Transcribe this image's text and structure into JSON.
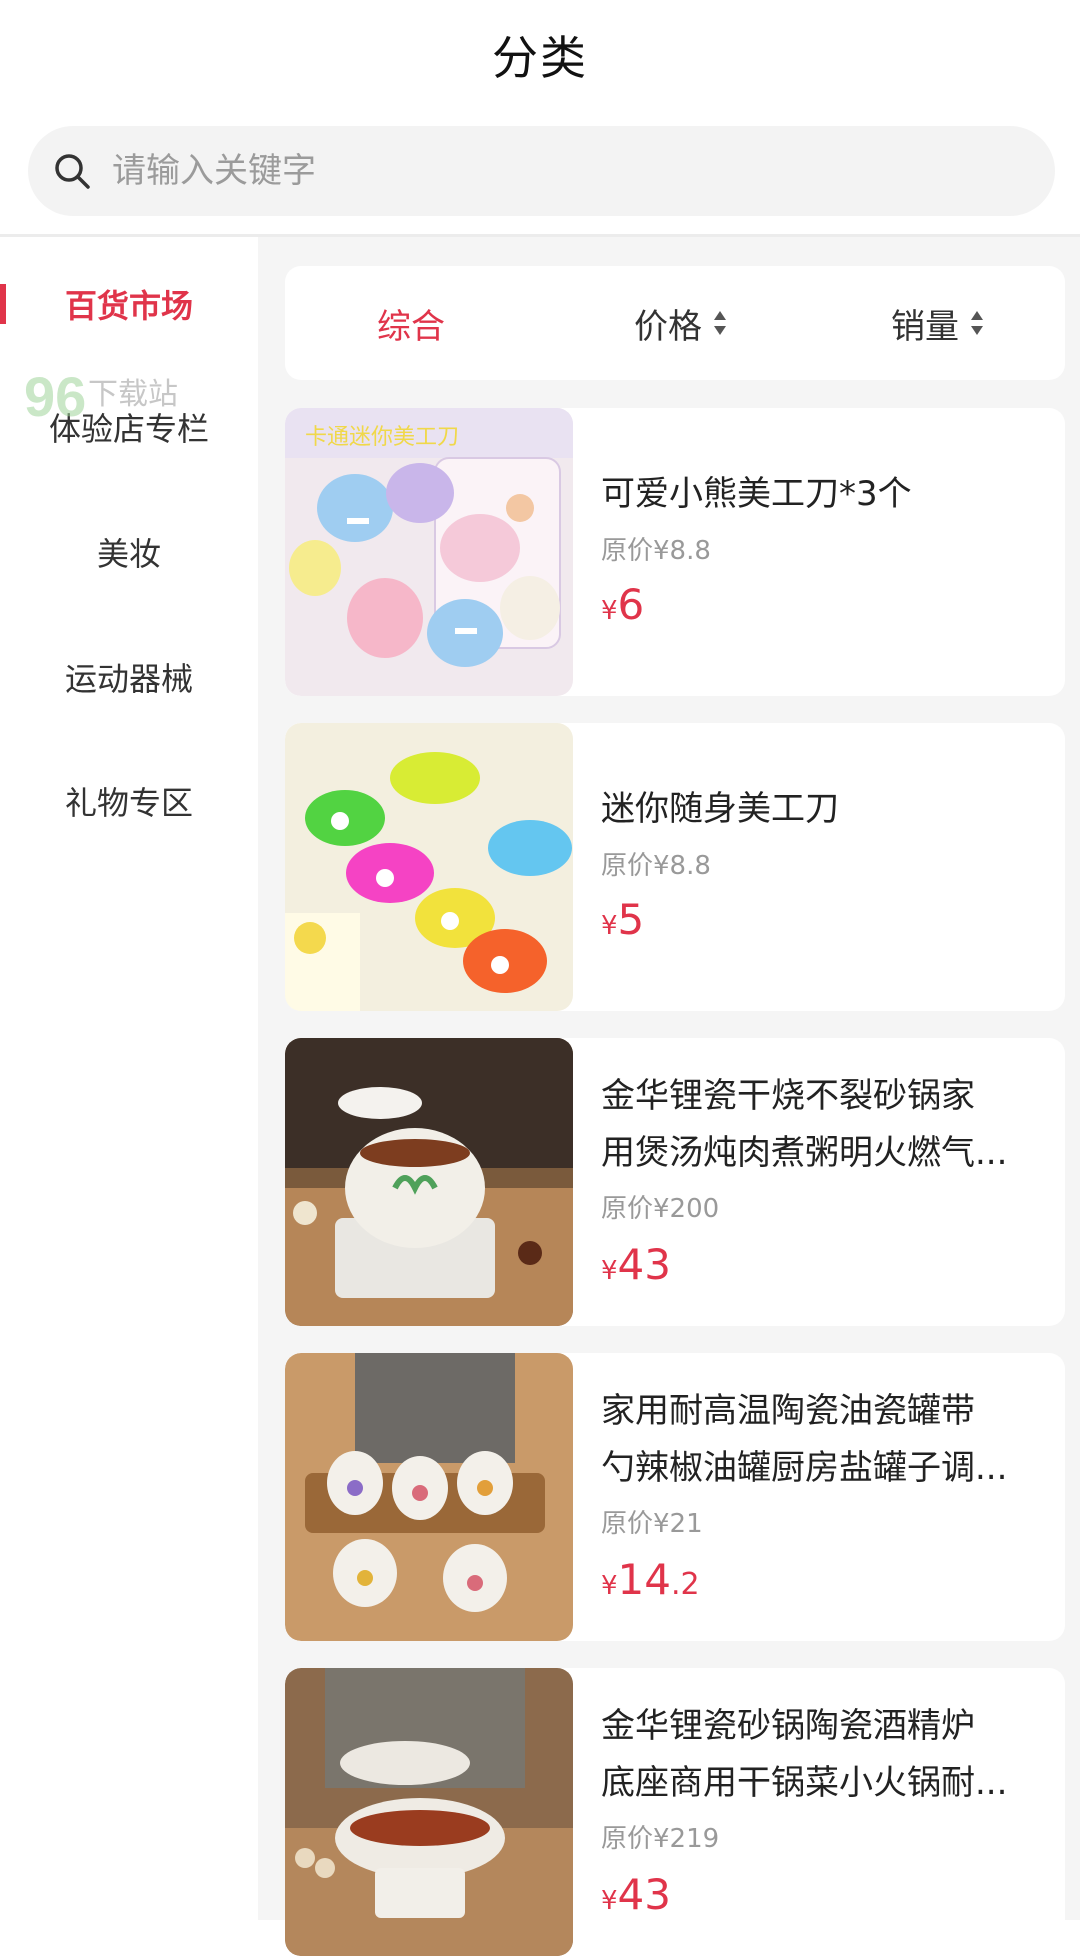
{
  "header": {
    "title": "分类"
  },
  "search": {
    "placeholder": "请输入关键字"
  },
  "watermark": {
    "number": "96",
    "text": "下载站"
  },
  "sidebar": {
    "items": [
      {
        "label": "百货市场",
        "active": true
      },
      {
        "label": "体验店专栏",
        "active": false
      },
      {
        "label": "美妆",
        "active": false
      },
      {
        "label": "运动器械",
        "active": false
      },
      {
        "label": "礼物专区",
        "active": false
      }
    ]
  },
  "sortbar": {
    "tabs": [
      {
        "label": "综合",
        "active": true
      },
      {
        "label": "价格",
        "active": false
      },
      {
        "label": "销量",
        "active": false
      }
    ]
  },
  "products": [
    {
      "name_lines": [
        "可爱小熊美工刀*3个"
      ],
      "original": "原价¥8.8",
      "currency": "¥",
      "price_int": "6",
      "price_dec": ""
    },
    {
      "name_lines": [
        "迷你随身美工刀"
      ],
      "original": "原价¥8.8",
      "currency": "¥",
      "price_int": "5",
      "price_dec": ""
    },
    {
      "name_lines": [
        "金华锂瓷干烧不裂砂锅家",
        "用煲汤炖肉煮粥明火燃气..."
      ],
      "original": "原价¥200",
      "currency": "¥",
      "price_int": "43",
      "price_dec": ""
    },
    {
      "name_lines": [
        "家用耐高温陶瓷油瓷罐带",
        "勺辣椒油罐厨房盐罐子调..."
      ],
      "original": "原价¥21",
      "currency": "¥",
      "price_int": "14",
      "price_dec": ".2"
    },
    {
      "name_lines": [
        "金华锂瓷砂锅陶瓷酒精炉",
        "底座商用干锅菜小火锅耐..."
      ],
      "original": "原价¥219",
      "currency": "¥",
      "price_int": "43",
      "price_dec": ""
    }
  ],
  "thumb_text": {
    "first": "卡通迷你美工刀"
  },
  "colors": {
    "accent": "#e0344a",
    "background": "#f5f5f5",
    "muted": "#999999"
  }
}
